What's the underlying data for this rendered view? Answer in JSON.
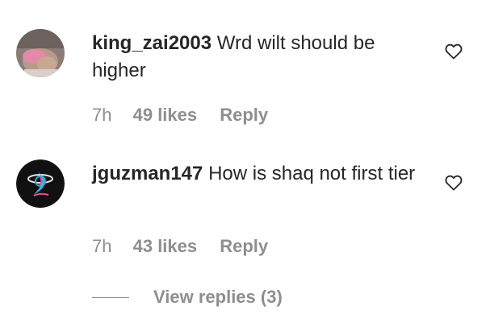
{
  "comments": [
    {
      "username": "king_zai2003",
      "text": "Wrd wilt should be higher",
      "time": "7h",
      "likes": "49 likes",
      "reply": "Reply",
      "avatar_icon": "user-photo-avatar"
    },
    {
      "username": "jguzman147",
      "text": "How is shaq not first tier",
      "time": "7h",
      "likes": "43 likes",
      "reply": "Reply",
      "avatar_icon": "miami-heat-logo-avatar"
    }
  ],
  "view_replies": "View replies (3)",
  "colors": {
    "text": "#262626",
    "muted": "#8e8e8e",
    "background": "#ffffff"
  }
}
